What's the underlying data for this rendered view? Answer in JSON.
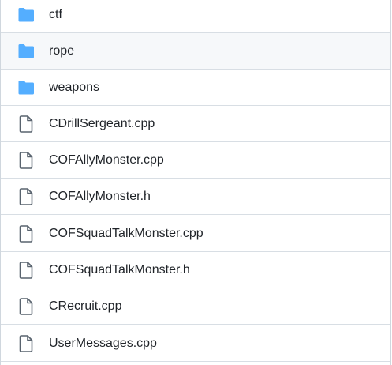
{
  "colors": {
    "folder": "#54aeff",
    "file_icon": "#59636e",
    "text": "#1f2328",
    "hover_bg": "#f6f8fa",
    "border": "#d8dee4"
  },
  "entries": [
    {
      "name": "ctf",
      "type": "folder",
      "icon": "folder-icon"
    },
    {
      "name": "rope",
      "type": "folder",
      "icon": "folder-icon",
      "hover": true
    },
    {
      "name": "weapons",
      "type": "folder",
      "icon": "folder-icon"
    },
    {
      "name": "CDrillSergeant.cpp",
      "type": "file",
      "icon": "file-icon"
    },
    {
      "name": "COFAllyMonster.cpp",
      "type": "file",
      "icon": "file-icon"
    },
    {
      "name": "COFAllyMonster.h",
      "type": "file",
      "icon": "file-icon"
    },
    {
      "name": "COFSquadTalkMonster.cpp",
      "type": "file",
      "icon": "file-icon"
    },
    {
      "name": "COFSquadTalkMonster.h",
      "type": "file",
      "icon": "file-icon"
    },
    {
      "name": "CRecruit.cpp",
      "type": "file",
      "icon": "file-icon"
    },
    {
      "name": "UserMessages.cpp",
      "type": "file",
      "icon": "file-icon"
    }
  ]
}
